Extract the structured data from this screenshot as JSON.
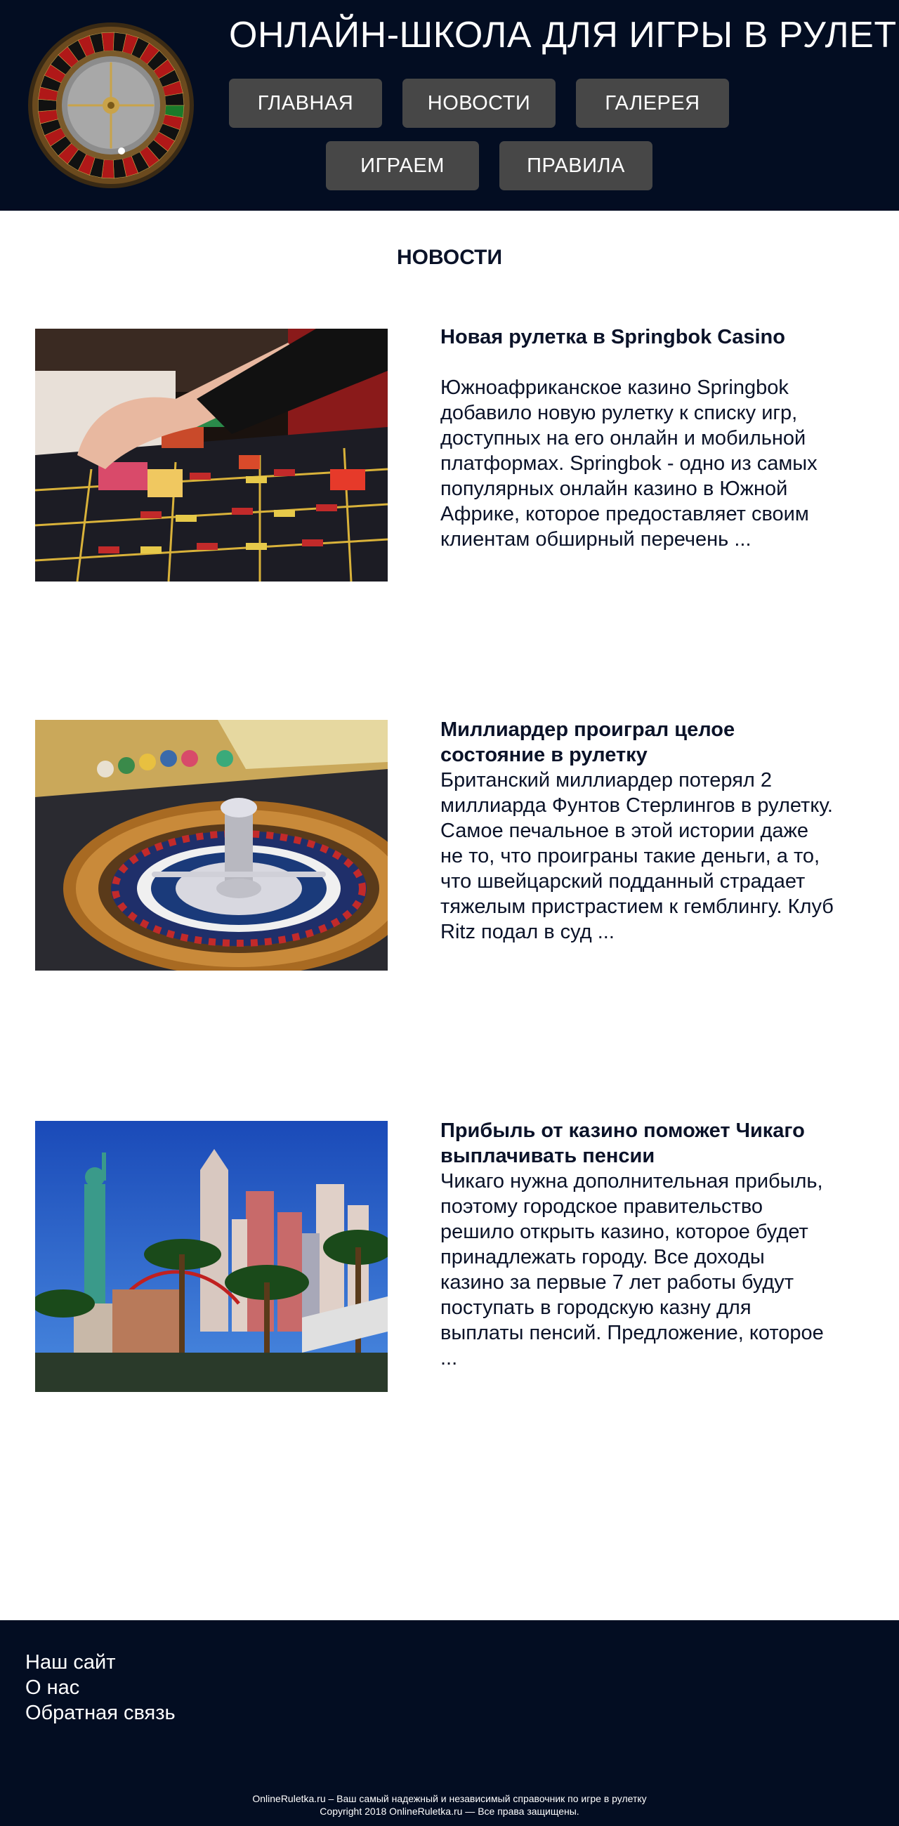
{
  "header": {
    "site_title": "ОНЛАЙН-ШКОЛА ДЛЯ ИГРЫ В РУЛЕТКУ",
    "logo_icon": "roulette-wheel-icon",
    "nav": [
      {
        "label": "ГЛАВНАЯ"
      },
      {
        "label": "НОВОСТИ"
      },
      {
        "label": "ГАЛЕРЕЯ"
      },
      {
        "label": "ИГРАЕМ"
      },
      {
        "label": "ПРАВИЛА"
      }
    ]
  },
  "main": {
    "section_title": "НОВОСТИ",
    "articles": [
      {
        "title": "Новая рулетка в Springbok Casino",
        "text": "Южноафриканское казино Springbok добавило новую рулетку к списку игр, доступных на его онлайн и мобильной платформах. Springbok - одно из самых популярных онлайн казино в Южной Африке, которое предоставляет своим клиентам обширный перечень ...",
        "image": "casino-table-chips-photo"
      },
      {
        "title": "Миллиардер проиграл целое состояние в рулетку",
        "text": "Британский миллиардер потерял 2 миллиарда Фунтов Стерлингов в рулетку. Самое печальное в этой истории даже не то, что проиграны такие деньги, а то, что швейцарский подданный страдает тяжелым пристрастием к гемблингу.  Клуб Ritz подал в суд ...",
        "image": "roulette-wheel-photo"
      },
      {
        "title": "Прибыль от казино поможет Чикаго выплачивать пенсии",
        "text": "Чикаго нужна дополнительная прибыль, поэтому городское правительство решило открыть казино, которое будет принадлежать городу. Все доходы казино за первые 7 лет работы будут поступать в городскую казну для выплаты пенсий.  Предложение, которое ...",
        "image": "las-vegas-skyline-photo"
      }
    ]
  },
  "footer": {
    "links": [
      {
        "label": "Наш сайт"
      },
      {
        "label": "О нас"
      },
      {
        "label": "Обратная связь"
      }
    ],
    "copy_line1": "OnlineRuletka.ru – Ваш самый надежный и независимый справочник по игре в рулетку",
    "copy_line2": "Copyright 2018 OnlineRuletka.ru — Все права защищены."
  },
  "colors": {
    "header_bg": "#030d22",
    "nav_button": "#474747",
    "text_dark": "#0a1228"
  }
}
